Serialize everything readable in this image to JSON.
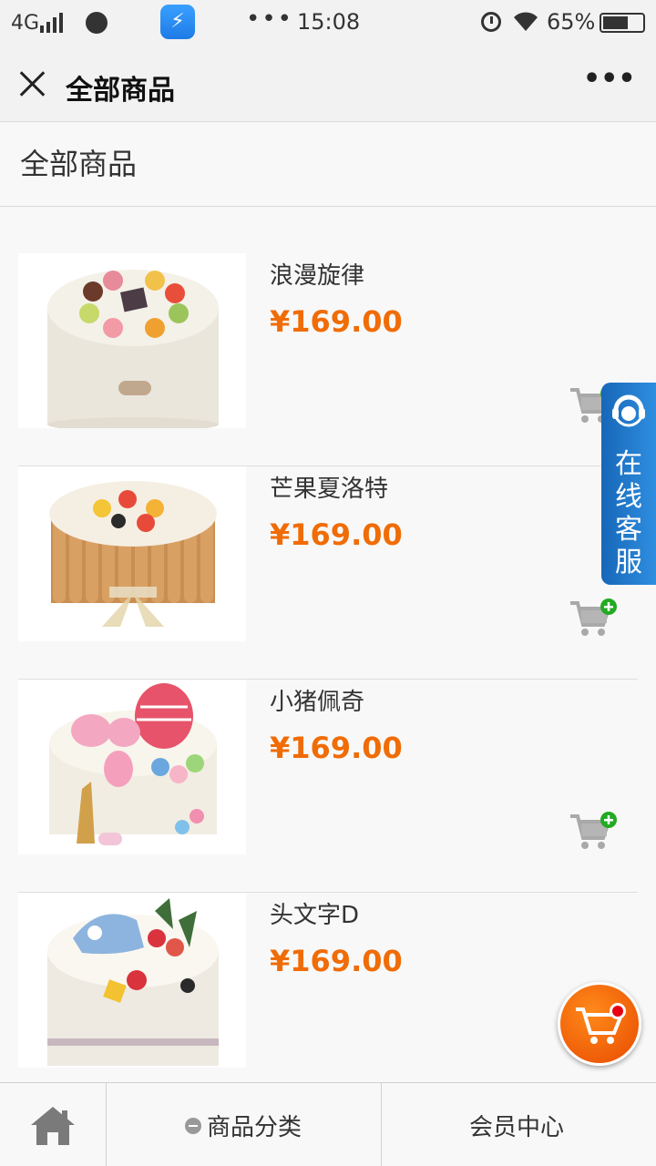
{
  "status_bar": {
    "network": "4G",
    "time": "15:08",
    "battery": "65%",
    "battery_level": 0.65,
    "overflow_dots": "•••"
  },
  "nav": {
    "title": "全部商品",
    "more_icon": "more-icon",
    "more_label": "•••"
  },
  "page": {
    "title": "全部商品"
  },
  "products": [
    {
      "name": "浪漫旋律",
      "price": "¥169.00"
    },
    {
      "name": "芒果夏洛特",
      "price": "¥169.00"
    },
    {
      "name": "小猪佩奇",
      "price": "¥169.00"
    },
    {
      "name": "头文字D",
      "price": "¥169.00"
    }
  ],
  "service": {
    "label": "在线客服"
  },
  "tabbar": {
    "home_icon": "home-icon",
    "category": "商品分类",
    "member": "会员中心"
  },
  "colors": {
    "price": "#f06c06",
    "service": "#1f7ad0",
    "cart": "#f05a00",
    "add_badge": "#22aa22"
  }
}
